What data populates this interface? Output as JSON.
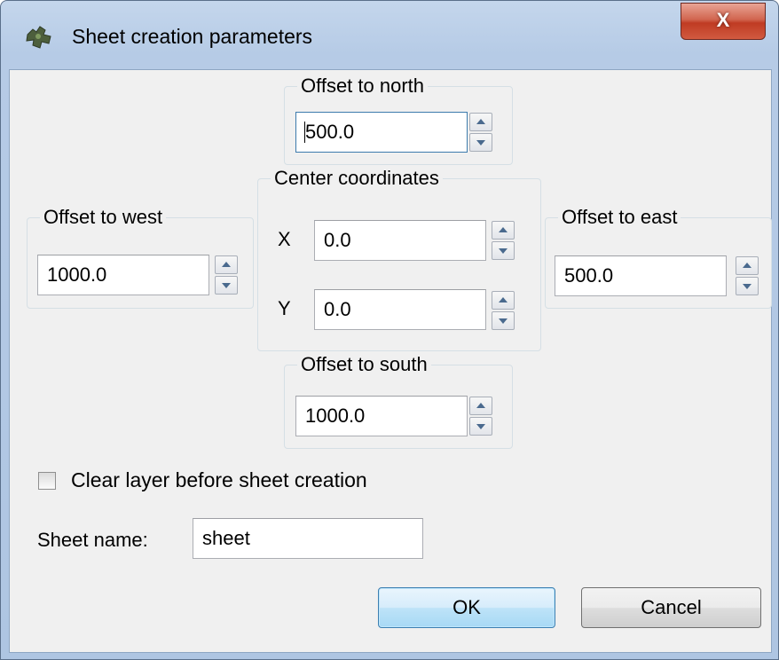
{
  "window": {
    "title": "Sheet creation parameters",
    "icon": "puzzle-icon",
    "close_label": "X"
  },
  "north": {
    "legend": "Offset to north",
    "value": "500.0"
  },
  "center": {
    "legend": "Center coordinates",
    "x_label": "X",
    "x_value": "0.0",
    "y_label": "Y",
    "y_value": "0.0"
  },
  "west": {
    "legend": "Offset to west",
    "value": "1000.0"
  },
  "east": {
    "legend": "Offset to east",
    "value": "500.0"
  },
  "south": {
    "legend": "Offset to south",
    "value": "1000.0"
  },
  "clear_layer": {
    "label": "Clear layer before sheet creation",
    "checked": false
  },
  "sheet_name": {
    "label": "Sheet name:",
    "value": "sheet"
  },
  "buttons": {
    "ok": "OK",
    "cancel": "Cancel"
  },
  "colors": {
    "accent_border": "#3c7fb1",
    "close_red": "#c94a30",
    "frame": "#b6cbe6"
  }
}
